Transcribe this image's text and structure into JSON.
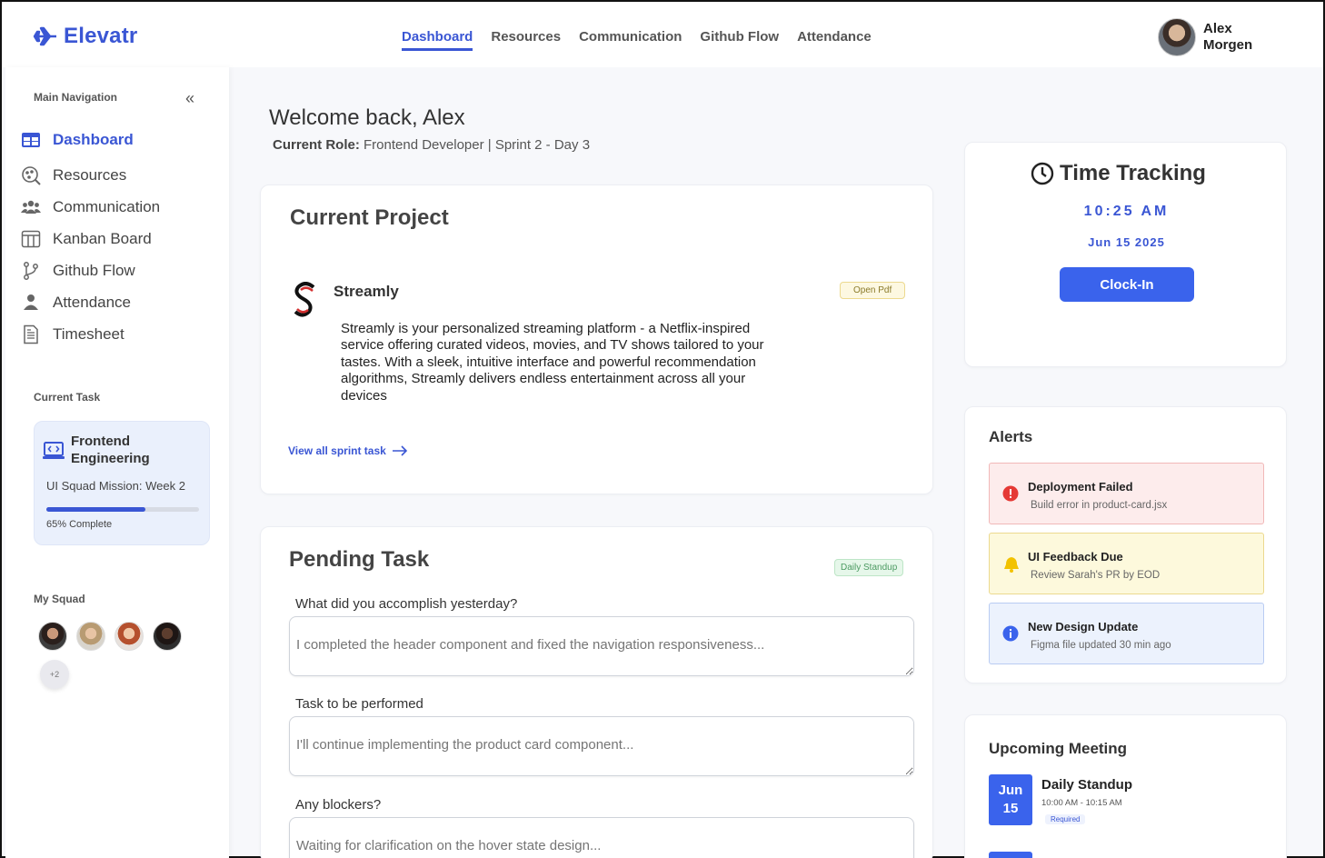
{
  "app": {
    "name": "Elevatr"
  },
  "header": {
    "nav": [
      {
        "label": "Dashboard",
        "active": true
      },
      {
        "label": "Resources"
      },
      {
        "label": "Communication"
      },
      {
        "label": "Github Flow"
      },
      {
        "label": "Attendance"
      }
    ],
    "user": {
      "name": "Alex Morgen"
    }
  },
  "sidebar": {
    "heading": "Main Navigation",
    "collapse_icon": "double-chevron-left-icon",
    "items": [
      {
        "label": "Dashboard",
        "icon": "dashboard-icon",
        "active": true
      },
      {
        "label": "Resources",
        "icon": "resources-icon"
      },
      {
        "label": "Communication",
        "icon": "users-icon"
      },
      {
        "label": "Kanban Board",
        "icon": "kanban-icon"
      },
      {
        "label": "Github Flow",
        "icon": "git-branch-icon"
      },
      {
        "label": "Attendance",
        "icon": "person-icon"
      },
      {
        "label": "Timesheet",
        "icon": "timesheet-icon"
      }
    ],
    "current_task_label": "Current Task",
    "current_task": {
      "title": "Frontend Engineering",
      "subtitle": "UI Squad Mission: Week 2",
      "progress": 0.65,
      "progress_text": "65% Complete"
    },
    "squad_label": "My Squad",
    "squad_more": "+2"
  },
  "main": {
    "welcome": "Welcome back, Alex",
    "role_label": "Current Role:",
    "role_value": "Frontend Developer | Sprint 2 - Day 3",
    "project": {
      "heading": "Current Project",
      "name": "Streamly",
      "pdf_label": "Open Pdf",
      "description": "Streamly is your personalized streaming platform - a Netflix-inspired service offering curated videos, movies, and TV shows tailored to your tastes. With a sleek, intuitive interface and powerful recommendation algorithms, Streamly delivers endless entertainment across all your devices",
      "view_all": "View all sprint task"
    },
    "pending": {
      "heading": "Pending Task",
      "badge": "Daily Standup",
      "questions": [
        {
          "label": "What did you accomplish yesterday?",
          "placeholder": "I completed the header component and fixed the navigation responsiveness..."
        },
        {
          "label": "Task to be performed",
          "placeholder": "I'll continue implementing the product card component..."
        },
        {
          "label": "Any blockers?",
          "placeholder": "Waiting for clarification on the hover state design..."
        }
      ]
    }
  },
  "right": {
    "time": {
      "title": "Time Tracking",
      "clock": "10:25 AM",
      "date": "Jun 15 2025",
      "button": "Clock-In"
    },
    "alerts": {
      "title": "Alerts",
      "items": [
        {
          "title": "Deployment Failed",
          "subtitle": "Build error in product-card.jsx",
          "type": "error",
          "color": "#e53935"
        },
        {
          "title": "UI Feedback Due",
          "subtitle": "Review Sarah's PR by EOD",
          "type": "warning",
          "color": "#f2c200"
        },
        {
          "title": "New Design Update",
          "subtitle": "Figma file updated 30 min ago",
          "type": "info",
          "color": "#3a63ec"
        }
      ]
    },
    "meeting": {
      "title": "Upcoming Meeting",
      "month": "Jun",
      "day": "15",
      "name": "Daily Standup",
      "time": "10:00 AM - 10:15 AM",
      "tag": "Required"
    }
  },
  "colors": {
    "accent": "#3a56d4",
    "button": "#3a63ec"
  }
}
